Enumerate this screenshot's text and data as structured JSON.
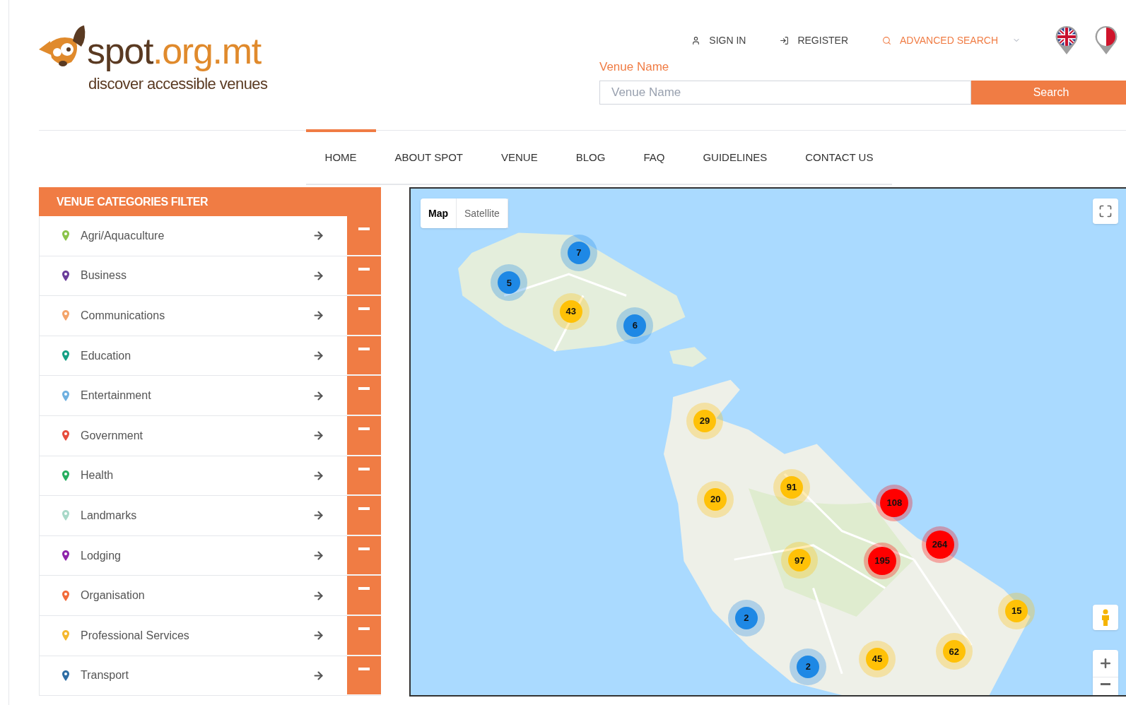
{
  "logo": {
    "wordmark": [
      "spot",
      ".org.mt"
    ],
    "tagline": "discover accessible venues"
  },
  "top_links": [
    {
      "kind": "link",
      "label": "SIGN IN"
    },
    {
      "kind": "link",
      "label": "REGISTER"
    },
    {
      "kind": "dropdown",
      "label": "ADVANCED SEARCH"
    }
  ],
  "search": {
    "label": "Venue Name",
    "placeholder": "Venue Name",
    "button": "Search"
  },
  "nav": [
    {
      "label": "HOME",
      "selected": true
    },
    {
      "label": "ABOUT SPOT",
      "selected": false
    },
    {
      "label": "VENUE",
      "selected": false
    },
    {
      "label": "BLOG",
      "selected": false
    },
    {
      "label": "FAQ",
      "selected": false
    },
    {
      "label": "GUIDELINES",
      "selected": false
    },
    {
      "label": "CONTACT US",
      "selected": false
    }
  ],
  "sidebar": {
    "title": "VENUE CATEGORIES FILTER",
    "items": [
      {
        "label": "Agri/Aquaculture",
        "color": "#8bc34a"
      },
      {
        "label": "Business",
        "color": "#6a3d9a"
      },
      {
        "label": "Communications",
        "color": "#f4a46a"
      },
      {
        "label": "Education",
        "color": "#16a085"
      },
      {
        "label": "Entertainment",
        "color": "#6fb0e0"
      },
      {
        "label": "Government",
        "color": "#e74c3c"
      },
      {
        "label": "Health",
        "color": "#27ae60"
      },
      {
        "label": "Landmarks",
        "color": "#a8d8c8"
      },
      {
        "label": "Lodging",
        "color": "#8e24aa"
      },
      {
        "label": "Organisation",
        "color": "#f26b3a"
      },
      {
        "label": "Professional Services",
        "color": "#f5b82e"
      },
      {
        "label": "Transport",
        "color": "#2e6da4"
      }
    ]
  },
  "map": {
    "kind": "picture",
    "map_types": [
      {
        "label": "Map",
        "selected": true
      },
      {
        "label": "Satellite",
        "selected": false
      }
    ],
    "clusters": [
      {
        "count": "7",
        "color": "#1e88e5"
      },
      {
        "count": "5",
        "color": "#1e88e5"
      },
      {
        "count": "43",
        "color": "#ffc107"
      },
      {
        "count": "6",
        "color": "#1e88e5"
      },
      {
        "count": "29",
        "color": "#ffc107"
      },
      {
        "count": "20",
        "color": "#ffc107"
      },
      {
        "count": "91",
        "color": "#ffc107"
      },
      {
        "count": "108",
        "color": "#ff0000"
      },
      {
        "count": "264",
        "color": "#ff0000"
      },
      {
        "count": "195",
        "color": "#ff0000"
      },
      {
        "count": "97",
        "color": "#ffc107"
      },
      {
        "count": "15",
        "color": "#ffc107"
      },
      {
        "count": "2",
        "color": "#1e88e5"
      },
      {
        "count": "2",
        "color": "#1e88e5"
      },
      {
        "count": "45",
        "color": "#ffc107"
      },
      {
        "count": "62",
        "color": "#ffc107"
      }
    ]
  }
}
